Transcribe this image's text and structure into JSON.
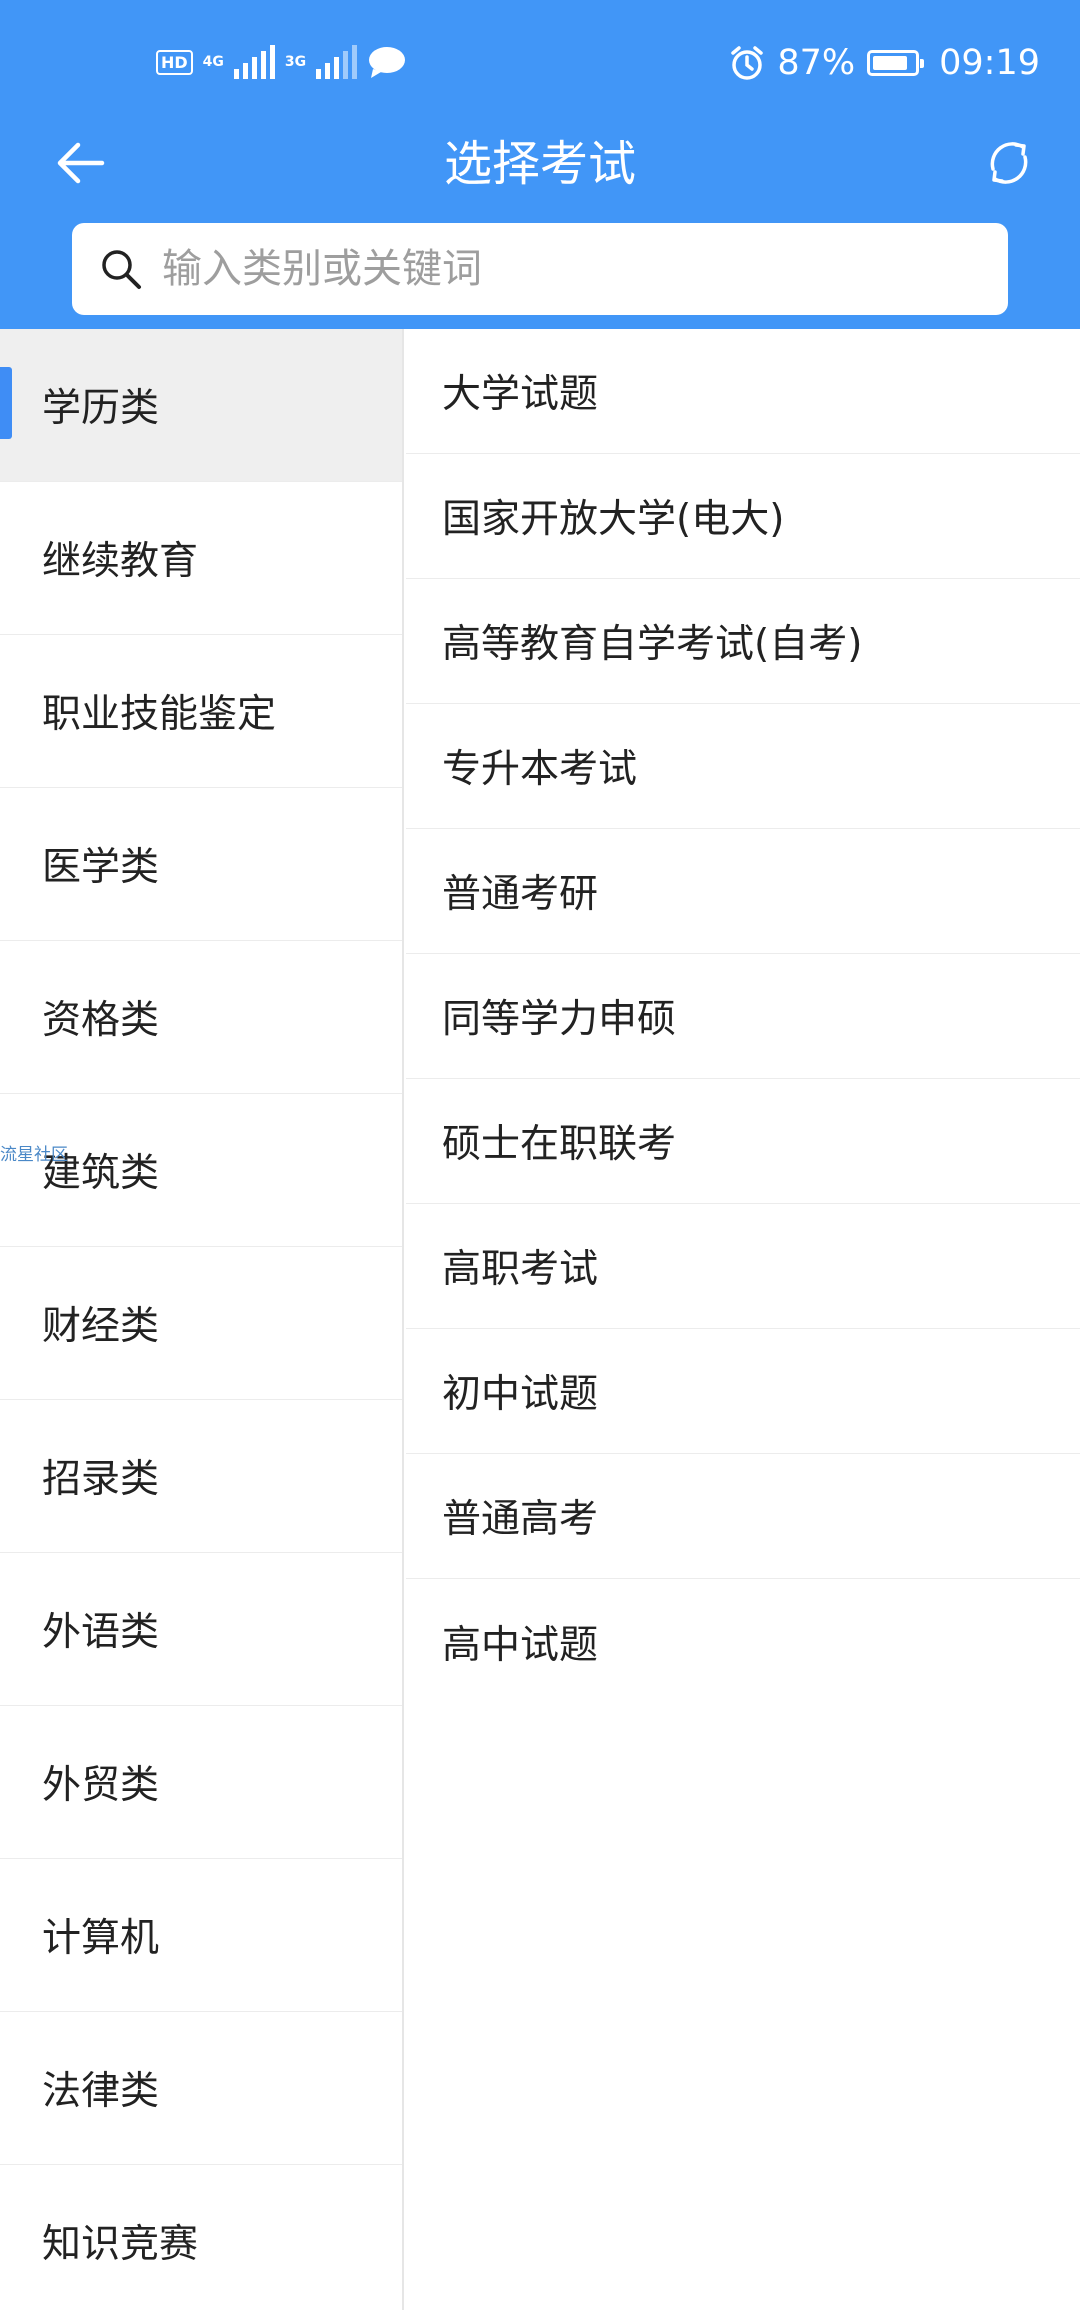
{
  "status_bar": {
    "network_hd": "HD",
    "sim1_type": "4G",
    "sim2_type": "3G",
    "battery_percent": "87%",
    "battery_level": 0.87,
    "time": "09:19"
  },
  "header": {
    "title": "选择考试"
  },
  "search": {
    "placeholder": "输入类别或关键词"
  },
  "sidebar": {
    "items": [
      {
        "label": "学历类",
        "active": true
      },
      {
        "label": "继续教育"
      },
      {
        "label": "职业技能鉴定"
      },
      {
        "label": "医学类"
      },
      {
        "label": "资格类"
      },
      {
        "label": "建筑类"
      },
      {
        "label": "财经类"
      },
      {
        "label": "招录类"
      },
      {
        "label": "外语类"
      },
      {
        "label": "外贸类"
      },
      {
        "label": "计算机"
      },
      {
        "label": "法律类"
      },
      {
        "label": "知识竞赛"
      }
    ]
  },
  "exams": {
    "items": [
      "大学试题",
      "国家开放大学(电大)",
      "高等教育自学考试(自考)",
      "专升本考试",
      "普通考研",
      "同等学力申硕",
      "硕士在职联考",
      "高职考试",
      "初中试题",
      "普通高考",
      "高中试题"
    ]
  },
  "watermark": "流星社区",
  "colors": {
    "header_bg": "#4196f7",
    "active_indicator": "#3f8df5",
    "active_bg": "#efefef"
  }
}
